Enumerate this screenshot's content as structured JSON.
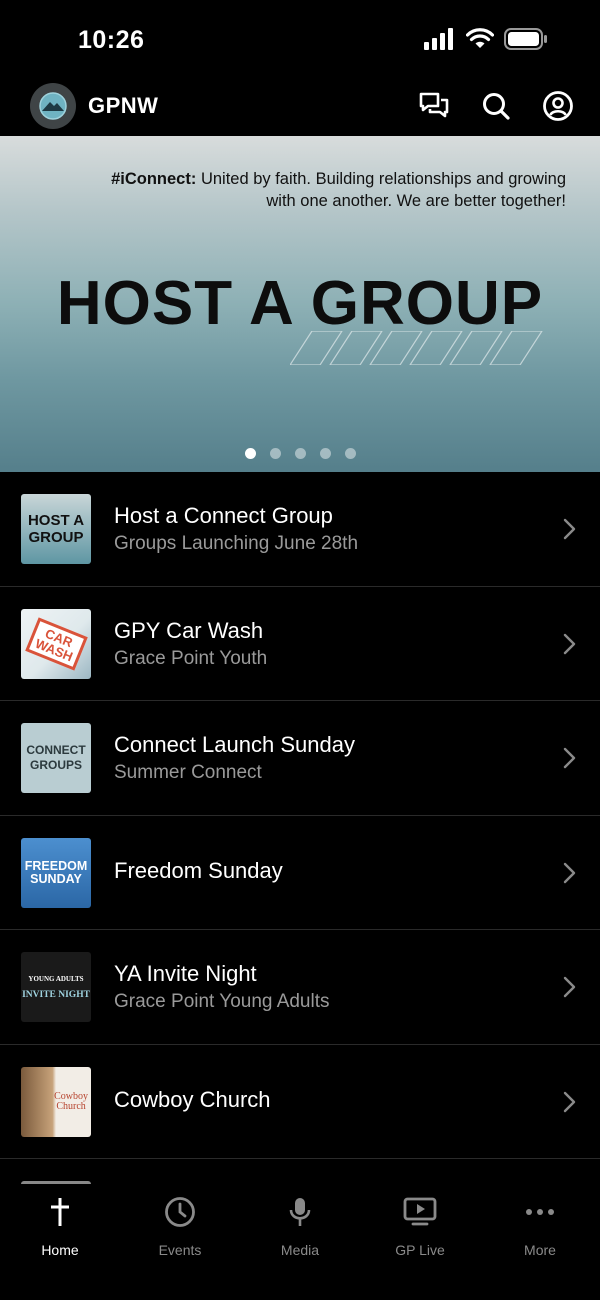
{
  "status_bar": {
    "time": "10:26",
    "icons": [
      "signal-icon",
      "wifi-icon",
      "battery-icon"
    ]
  },
  "header": {
    "title": "GPNW",
    "actions": [
      "chat-icon",
      "search-icon",
      "profile-icon"
    ]
  },
  "hero": {
    "tag": "#iConnect:",
    "tagline": "United by faith. Building relationships and growing with one another. We are better together!",
    "title": "HOST A GROUP",
    "page_count": 5,
    "active_page": 1
  },
  "items": [
    {
      "title": "Host a Connect Group",
      "subtitle": "Groups Launching June 28th",
      "thumb": {
        "lines": [
          "HOST A",
          "GROUP"
        ]
      }
    },
    {
      "title": "GPY Car Wash",
      "subtitle": "Grace Point Youth",
      "thumb": {
        "lines": [
          "CAR",
          "WASH"
        ]
      }
    },
    {
      "title": "Connect Launch Sunday",
      "subtitle": "Summer Connect",
      "thumb": {
        "lines": [
          "CONNECT",
          "GROUPS"
        ]
      }
    },
    {
      "title": "Freedom Sunday",
      "subtitle": "",
      "thumb": {
        "lines": [
          "FREEDOM",
          "SUNDAY"
        ]
      }
    },
    {
      "title": "YA Invite Night",
      "subtitle": "Grace Point Young Adults",
      "thumb": {
        "lines": [
          "YOUNG ADULTS",
          "INVITE NIGHT"
        ]
      }
    },
    {
      "title": "Cowboy Church",
      "subtitle": "",
      "thumb": {
        "lines": [
          "Cowboy",
          "Church"
        ]
      }
    }
  ],
  "tabs": [
    {
      "label": "Home",
      "icon": "cross-icon",
      "active": true
    },
    {
      "label": "Events",
      "icon": "clock-icon",
      "active": false
    },
    {
      "label": "Media",
      "icon": "microphone-icon",
      "active": false
    },
    {
      "label": "GP Live",
      "icon": "tv-play-icon",
      "active": false
    },
    {
      "label": "More",
      "icon": "more-dots-icon",
      "active": false
    }
  ],
  "colors": {
    "background": "#000000",
    "subtitle": "#9a9a9a",
    "inactive_tab": "#8a8a8a",
    "divider": "#2a2a2a"
  }
}
